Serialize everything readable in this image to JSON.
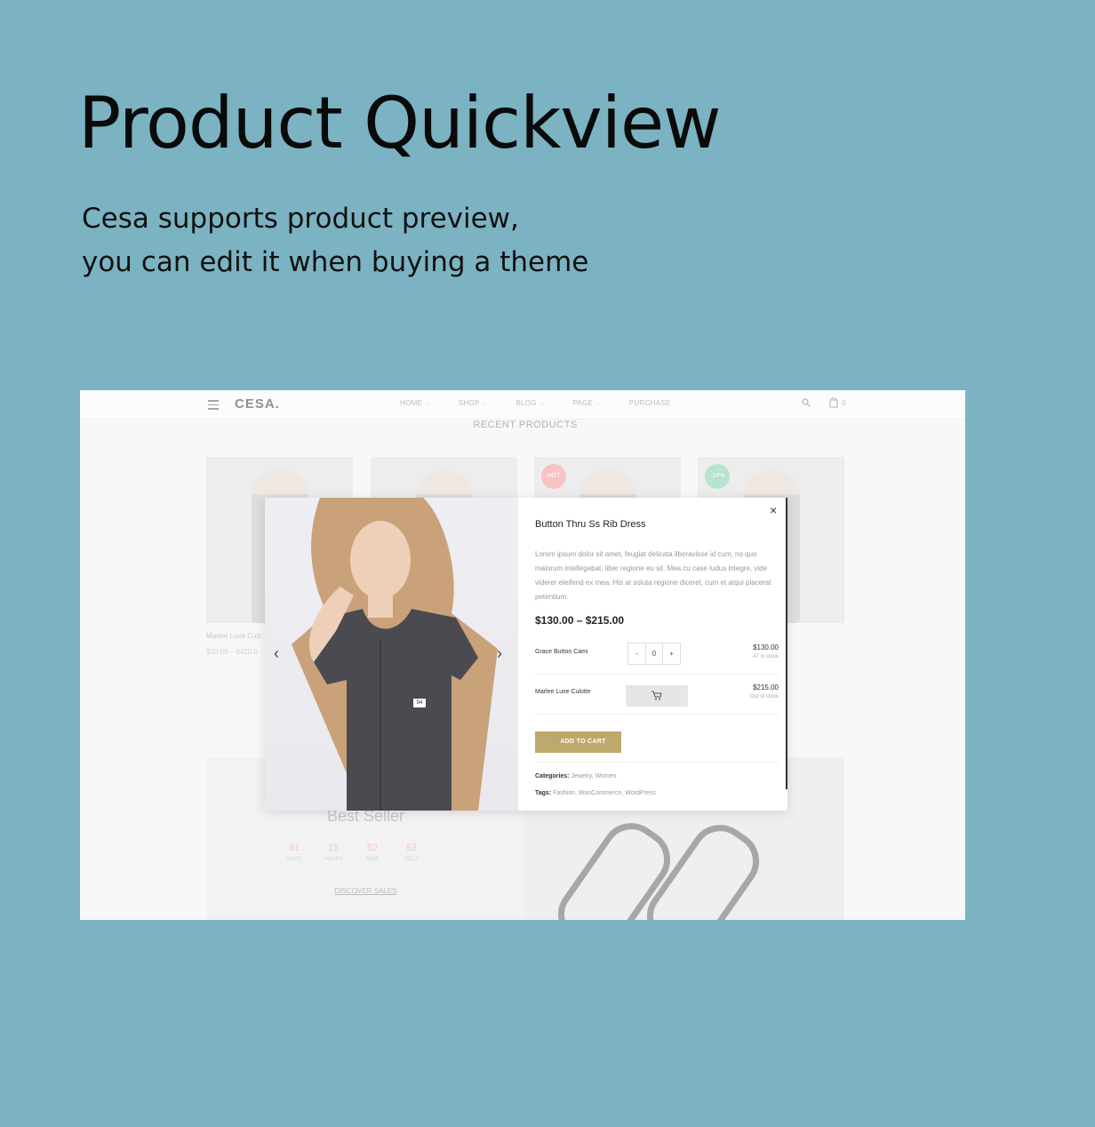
{
  "hero": {
    "title": "Product Quickview",
    "subtitle_line1": "Cesa supports product preview,",
    "subtitle_line2": "you can edit it when buying a theme"
  },
  "site": {
    "logo": "CESA.",
    "nav": [
      "HOME",
      "SHOP",
      "BLOG",
      "PAGE",
      "PURCHASE"
    ],
    "cart_count": "0",
    "section_title": "RECENT PRODUCTS",
    "badges": {
      "hot": "HOT",
      "sale": "-14%"
    },
    "under_product_name": "Marlee Luxe Culc",
    "under_product_price": "$20.00 – $420.0",
    "best_seller": "Best Seller",
    "countdown": [
      {
        "value": "91",
        "label": "DAYS"
      },
      {
        "value": "15",
        "label": "HOURS"
      },
      {
        "value": "52",
        "label": "MINS"
      },
      {
        "value": "53",
        "label": "SECS"
      }
    ],
    "discover_link": "DISCOVER SALES"
  },
  "quickview": {
    "close": "×",
    "image_tag": "94",
    "title": "Button Thru Ss Rib Dress",
    "description": "Lorem ipsum dolor sit amet, feugiat delicata liberavisse id cum, no quo maiorum intellegebat, liber regione eu sit. Mea cu case ludus integre, vide viderer eleifend ex mea. His at soluta regione diceret, cum et atqui placerat petentium.",
    "price_range": "$130.00 – $215.00",
    "items": [
      {
        "name": "Grace Button Cami",
        "qty": "0",
        "price": "$130.00",
        "stock": "47 in stock"
      },
      {
        "name": "Marlee Luxe Culotte",
        "price": "$215.00",
        "stock": "Out of stock"
      }
    ],
    "qty_minus": "-",
    "qty_plus": "+",
    "add_to_cart": "ADD TO CART",
    "categories_label": "Categories:",
    "categories": "Jewelry, Women",
    "tags_label": "Tags:",
    "tags": "Fashion, WooCommerce, WordPress"
  },
  "colors": {
    "page_bg": "#7bb3c2",
    "accent_gold": "#bfa96a",
    "hot_badge": "#f3a3a3",
    "sale_badge": "#8fd6b4"
  }
}
